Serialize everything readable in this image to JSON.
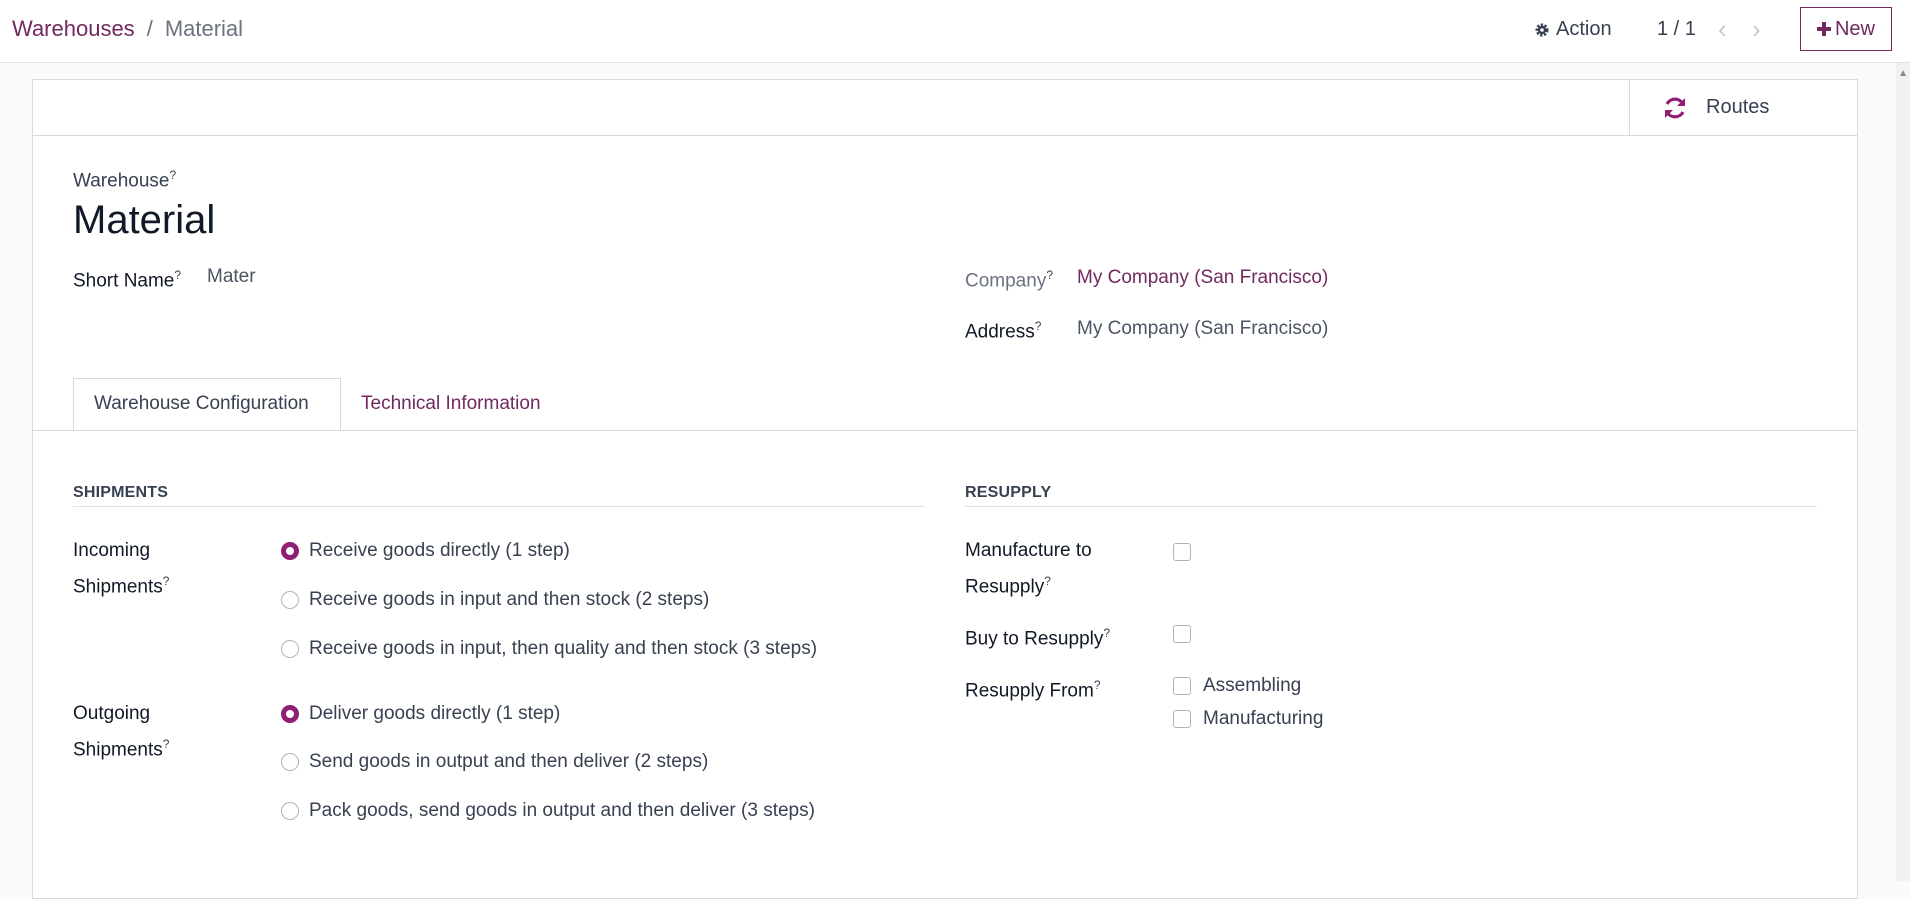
{
  "breadcrumb": {
    "parent": "Warehouses",
    "separator": "/",
    "current": "Material"
  },
  "control": {
    "action_label": "Action",
    "pager": "1 / 1",
    "new_label": "New"
  },
  "smart_buttons": {
    "routes_label": "Routes"
  },
  "form": {
    "warehouse_label": "Warehouse",
    "name": "Material",
    "short_name_label": "Short Name",
    "short_name_value": "Mater",
    "company_label": "Company",
    "company_value": "My Company (San Francisco)",
    "address_label": "Address",
    "address_value": "My Company (San Francisco)",
    "help_marker": "?"
  },
  "tabs": [
    {
      "label": "Warehouse Configuration"
    },
    {
      "label": "Technical Information"
    }
  ],
  "shipments": {
    "title": "SHIPMENTS",
    "incoming_label_1": "Incoming",
    "incoming_label_2": "Shipments",
    "incoming_options": [
      "Receive goods directly (1 step)",
      "Receive goods in input and then stock (2 steps)",
      "Receive goods in input, then quality and then stock (3 steps)"
    ],
    "incoming_selected": 0,
    "outgoing_label_1": "Outgoing",
    "outgoing_label_2": "Shipments",
    "outgoing_options": [
      "Deliver goods directly (1 step)",
      "Send goods in output and then deliver (2 steps)",
      "Pack goods, send goods in output and then deliver (3 steps)"
    ],
    "outgoing_selected": 0
  },
  "resupply": {
    "title": "RESUPPLY",
    "manufacture_label_1": "Manufacture to",
    "manufacture_label_2": "Resupply",
    "manufacture_checked": false,
    "buy_label": "Buy to Resupply",
    "buy_checked": false,
    "resupply_from_label": "Resupply From",
    "resupply_from_options": [
      "Assembling",
      "Manufacturing"
    ]
  },
  "colors": {
    "accent": "#71295f",
    "radio_checked": "#8f1f73"
  },
  "icons": {
    "action": "gear-icon",
    "prev": "chevron-left-icon",
    "next": "chevron-right-icon",
    "new": "plus-icon",
    "routes": "refresh-icon"
  }
}
